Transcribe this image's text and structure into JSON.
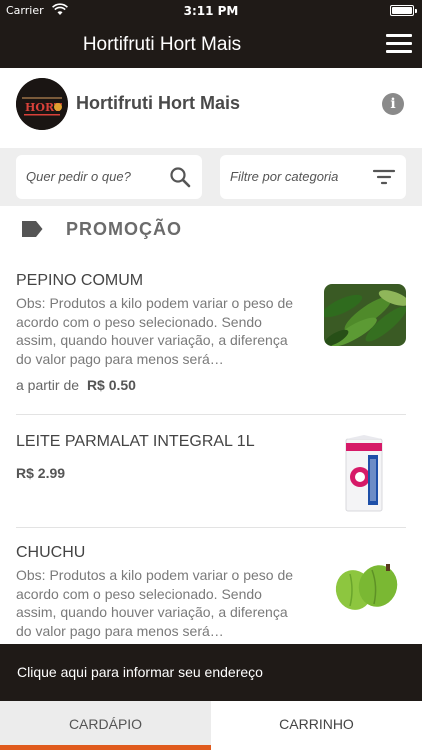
{
  "status_bar": {
    "carrier": "Carrier",
    "time": "3:11 PM"
  },
  "nav": {
    "title": "Hortifruti Hort Mais",
    "menu_icon": "hamburger-menu-icon"
  },
  "store": {
    "name": "Hortifruti Hort Mais",
    "logo_text": "HORT",
    "info_icon": "i"
  },
  "search": {
    "placeholder": "Quer pedir o que?"
  },
  "category_filter": {
    "placeholder": "Filtre por categoria"
  },
  "section": {
    "title": "PROMOÇÃO"
  },
  "products": [
    {
      "name": "PEPINO COMUM",
      "description": "Obs: Produtos a kilo podem variar o peso de acordo com o peso selecionado. Sendo assim, quando houver variação, a diferença do valor pago para menos será…",
      "price_prefix": "a partir de",
      "price": "R$ 0.50"
    },
    {
      "name": "LEITE PARMALAT INTEGRAL 1L",
      "description": "",
      "price_prefix": "",
      "price": "R$ 2.99"
    },
    {
      "name": "CHUCHU",
      "description": "Obs: Produtos a kilo podem variar o peso de acordo com o peso selecionado. Sendo assim, quando houver variação, a diferença do valor pago para menos será…",
      "price_prefix": "",
      "price": ""
    }
  ],
  "address_bar": {
    "text": "Clique aqui para informar seu endereço"
  },
  "tabs": {
    "menu": "CARDÁPIO",
    "cart": "CARRINHO"
  },
  "colors": {
    "dark": "#1f1a17",
    "accent": "#e05a1c",
    "filter_bg": "#eeeeee"
  }
}
